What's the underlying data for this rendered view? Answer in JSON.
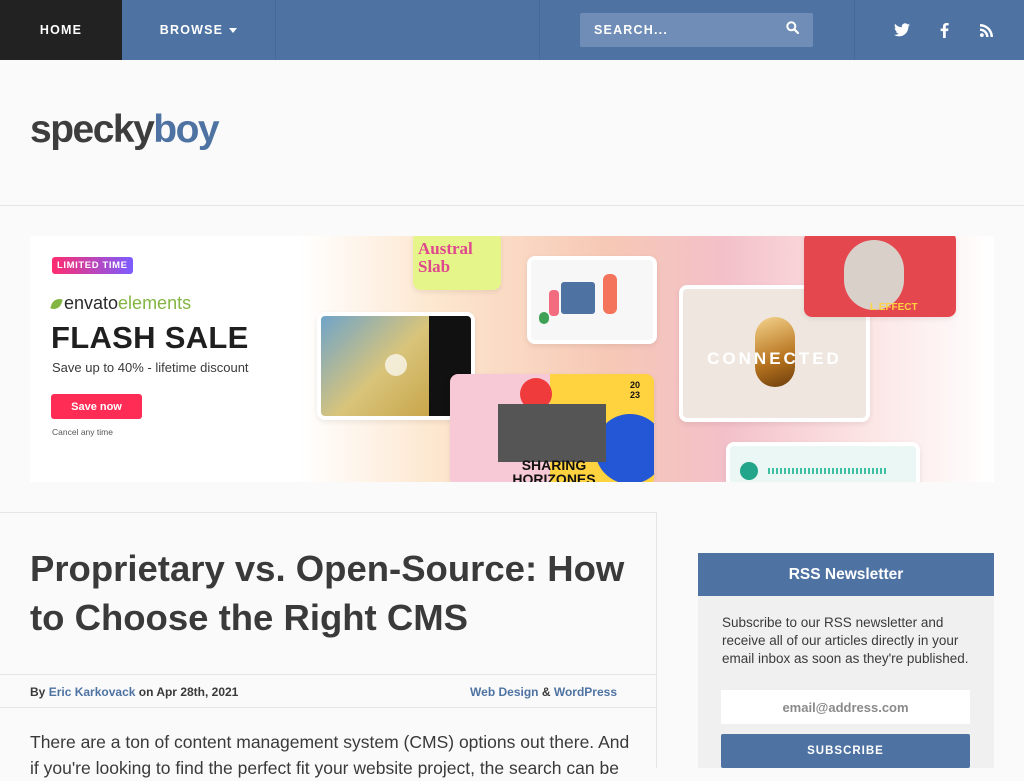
{
  "nav": {
    "home": "HOME",
    "browse": "BROWSE",
    "search_placeholder": "SEARCH..."
  },
  "logo": {
    "part1": "specky",
    "part2": "boy"
  },
  "banner": {
    "badge": "LIMITED TIME",
    "brand_a": "envato",
    "brand_b": "elements",
    "headline": "FLASH SALE",
    "subtext": "Save up to 40% - lifetime discount",
    "cta": "Save now",
    "cancel": "Cancel any time",
    "card_font_title": "Austral Slab",
    "card_connected": "CONNECTED",
    "card_sharing": "SHARING HORIZONES",
    "card_effect": "L EFFECT",
    "card_number": "20 23"
  },
  "article": {
    "title": "Proprietary vs. Open-Source: How to Choose the Right CMS",
    "by": "By",
    "author": "Eric Karkovack",
    "on": "on Apr 28th, 2021",
    "category1": "Web Design",
    "amp": "&",
    "category2": "WordPress",
    "intro": "There are a ton of content management system (CMS) options out there. And if you're looking to find the perfect fit your website project, the search can be"
  },
  "sidebar": {
    "heading": "RSS Newsletter",
    "text": "Subscribe to our RSS newsletter and receive all of our articles directly in your email inbox as soon as they're published.",
    "email_placeholder": "email@address.com",
    "button": "SUBSCRIBE"
  },
  "colors": {
    "primary": "#4e73a3",
    "dark": "#222222",
    "accent": "#ff2d55"
  }
}
